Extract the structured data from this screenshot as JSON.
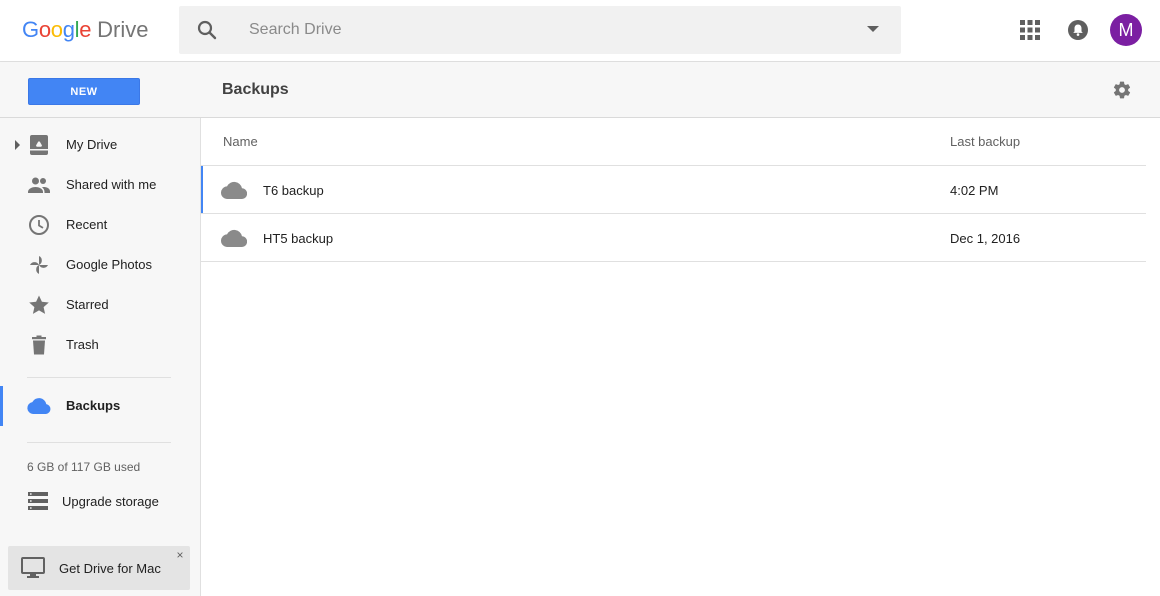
{
  "header": {
    "logo_google": [
      "G",
      "o",
      "o",
      "g",
      "l",
      "e"
    ],
    "logo_google_colors": [
      "#4285f4",
      "#ea4335",
      "#fbbc05",
      "#4285f4",
      "#34a853",
      "#ea4335"
    ],
    "logo_product": "Drive",
    "search_placeholder": "Search Drive",
    "apps_icon": "apps-grid-icon",
    "notifications_icon": "bell-icon",
    "avatar_letter": "M",
    "avatar_color": "#7b1fa2"
  },
  "toolbar": {
    "new_label": "NEW",
    "page_title": "Backups",
    "settings_icon": "gear-icon"
  },
  "sidebar": {
    "items": [
      {
        "label": "My Drive",
        "icon": "my-drive-icon"
      },
      {
        "label": "Shared with me",
        "icon": "people-icon"
      },
      {
        "label": "Recent",
        "icon": "clock-icon"
      },
      {
        "label": "Google Photos",
        "icon": "pinwheel-icon"
      },
      {
        "label": "Starred",
        "icon": "star-icon"
      },
      {
        "label": "Trash",
        "icon": "trash-icon"
      },
      {
        "label": "Backups",
        "icon": "cloud-icon",
        "active": true
      }
    ],
    "storage_text": "6 GB of 117 GB used",
    "upgrade_label": "Upgrade storage",
    "promo_label": "Get Drive for Mac",
    "promo_close": "×"
  },
  "list": {
    "columns": {
      "name": "Name",
      "last_backup": "Last backup"
    },
    "rows": [
      {
        "name": "T6 backup",
        "last_backup": "4:02 PM",
        "selected": true
      },
      {
        "name": "HT5 backup",
        "last_backup": "Dec 1, 2016",
        "selected": false
      }
    ]
  },
  "colors": {
    "accent": "#4285f4",
    "icon_gray": "#757575"
  }
}
